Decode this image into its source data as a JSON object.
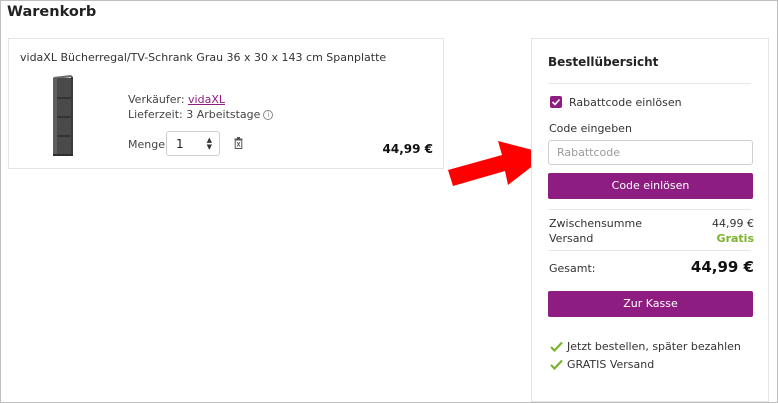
{
  "page": {
    "title": "Warenkorb"
  },
  "product": {
    "name": "vidaXL Bücherregal/TV-Schrank Grau 36 x 30 x 143 cm Spanplatte",
    "seller_label": "Verkäufer:",
    "seller_name": "vidaXL",
    "delivery": "Lieferzeit: 3 Arbeitstage",
    "quantity_label": "Menge",
    "quantity_value": "1",
    "price": "44,99 €"
  },
  "summary": {
    "title": "Bestellübersicht",
    "coupon_toggle_label": "Rabattcode einlösen",
    "coupon_checked": true,
    "code_label": "Code eingeben",
    "code_value": "",
    "code_placeholder": "Rabattcode",
    "redeem_button": "Code einlösen",
    "subtotal_label": "Zwischensumme",
    "subtotal_value": "44,99 €",
    "shipping_label": "Versand",
    "shipping_value": "Gratis",
    "total_label": "Gesamt:",
    "total_value": "44,99 €",
    "checkout_button": "Zur Kasse",
    "benefits": [
      "Jetzt bestellen, später bezahlen",
      "GRATIS Versand"
    ]
  },
  "colors": {
    "brand": "#8e1d82",
    "success": "#7bb32e",
    "annotation_arrow": "#ff0000"
  },
  "icons": {
    "info": "info-icon",
    "delete": "trash-icon",
    "check": "check-icon",
    "arrow": "arrow-right-icon"
  }
}
